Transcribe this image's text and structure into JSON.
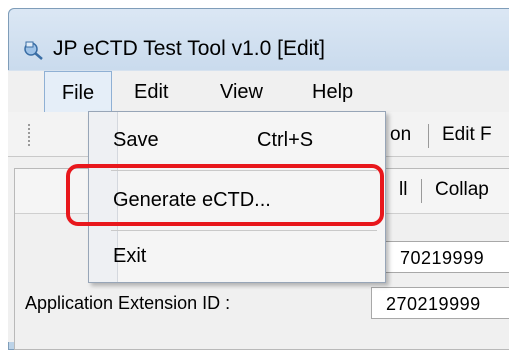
{
  "window": {
    "title": "JP eCTD Test Tool v1.0 [Edit]"
  },
  "menubar": {
    "items": [
      "File",
      "Edit",
      "View",
      "Help"
    ]
  },
  "file_menu": {
    "items": [
      {
        "label": "Save",
        "shortcut": "Ctrl+S"
      },
      {
        "label": "Generate eCTD..."
      },
      {
        "label": "Exit"
      }
    ]
  },
  "toolbar1": {
    "partial_1": "on",
    "partial_2": "Edit F"
  },
  "toolbar2": {
    "partial_1": "ll",
    "partial_2": "Collap"
  },
  "form": {
    "field_partial_value": "70219999",
    "application_extension_id_label": "Application Extension ID :",
    "application_extension_id_value": "270219999"
  },
  "colors": {
    "highlight": "#e8171c",
    "titlebar": "#c7d9ec"
  }
}
